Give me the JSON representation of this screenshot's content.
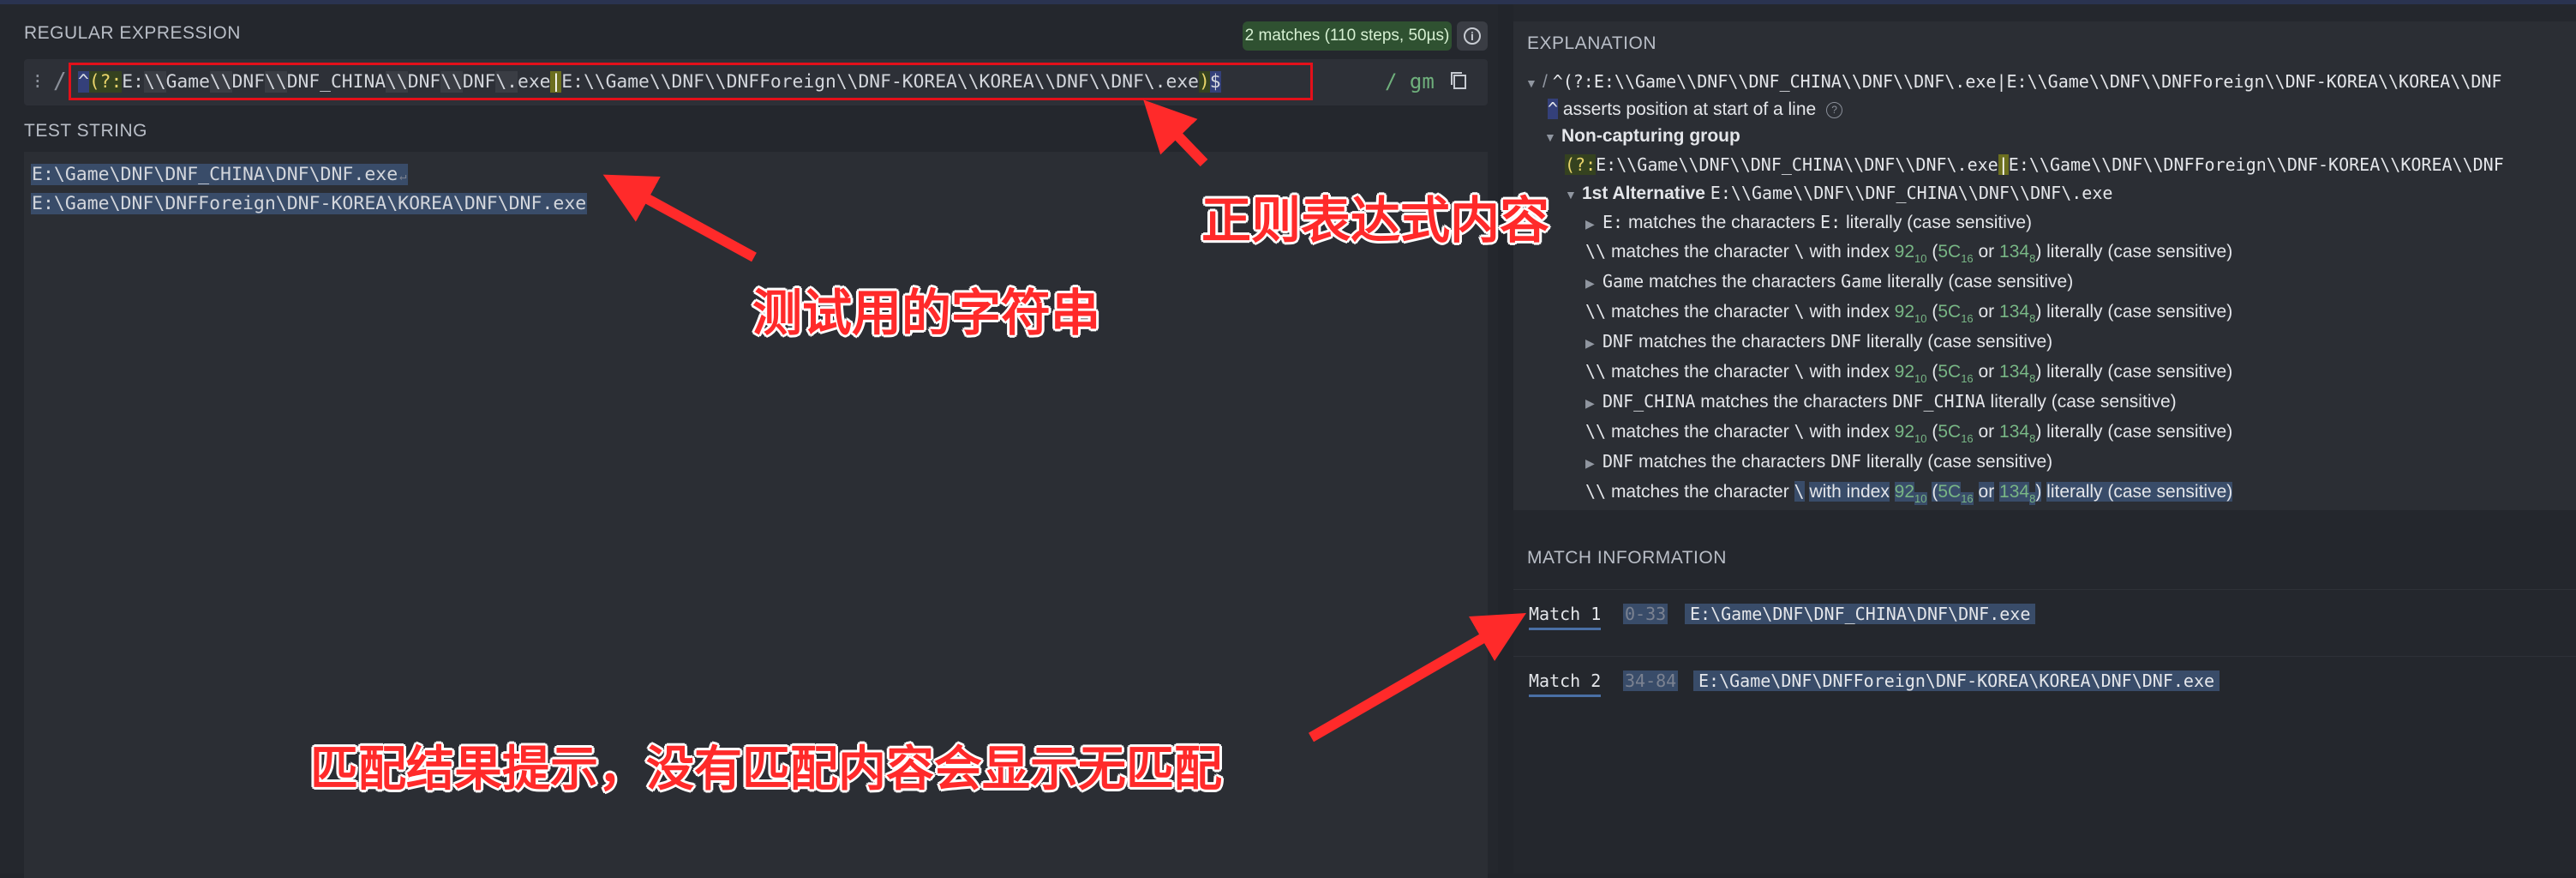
{
  "regex_panel": {
    "label": "REGULAR EXPRESSION",
    "match_badge": "2 matches (110 steps, 50µs)",
    "handle": "⁝",
    "open_delimiter": "/",
    "pattern_parts": {
      "anchor_start": "^",
      "group_open": "(?:",
      "alt1_a": "E:",
      "alt1_b": "\\\\",
      "alt1_c": "Game",
      "alt1_d": "\\\\",
      "alt1_e": "DNF",
      "alt1_f": "\\\\",
      "alt1_g": "DNF_CHINA",
      "alt1_h": "\\\\",
      "alt1_i": "DNF",
      "alt1_j": "\\\\",
      "alt1_k": "DNF",
      "alt1_l": "\\.",
      "alt1_m": "exe",
      "alt_bar": "|",
      "alt2": "E:\\\\Game\\\\DNF\\\\DNFForeign\\\\DNF-KOREA\\\\KOREA\\\\DNF\\\\DNF\\.exe",
      "group_close": ")",
      "anchor_end": "$"
    },
    "flags": "/ gm"
  },
  "test_panel": {
    "label": "TEST STRING",
    "lines": [
      "E:\\Game\\DNF\\DNF_CHINA\\DNF\\DNF.exe",
      "E:\\Game\\DNF\\DNFForeign\\DNF-KOREA\\KOREA\\DNF\\DNF.exe"
    ],
    "newline_mark": "↵"
  },
  "explanation": {
    "label": "EXPLANATION",
    "top_slash": "/",
    "top_pattern": "^(?:E:\\\\Game\\\\DNF\\\\DNF_CHINA\\\\DNF\\\\DNF\\.exe|E:\\\\Game\\\\DNF\\\\DNFForeign\\\\DNF-KOREA\\\\KOREA\\\\DNF",
    "caret_token": "^",
    "caret_text": "asserts position at start of a line",
    "group_title": "Non-capturing group",
    "group_pattern_prefix": "(?:",
    "group_pattern_rest": "E:\\\\Game\\\\DNF\\\\DNF_CHINA\\\\DNF\\\\DNF\\.exe",
    "group_pattern_bar": "|",
    "group_pattern_tail": "E:\\\\Game\\\\DNF\\\\DNFForeign\\\\DNF-KOREA\\\\KOREA\\\\DNF",
    "alt_title": "1st Alternative",
    "alt_code": "E:\\\\Game\\\\DNF\\\\DNF_CHINA\\\\DNF\\\\DNF\\.exe",
    "literal_rows": [
      {
        "token": "E:",
        "prefix": "matches the characters",
        "code": "E:",
        "suffix": "literally (case sensitive)"
      },
      {
        "token": "Game",
        "prefix": "matches the characters",
        "code": "Game",
        "suffix": "literally (case sensitive)"
      },
      {
        "token": "DNF",
        "prefix": "matches the characters",
        "code": "DNF",
        "suffix": "literally (case sensitive)"
      },
      {
        "token": "DNF_CHINA",
        "prefix": "matches the characters",
        "code": "DNF_CHINA",
        "suffix": "literally (case sensitive)"
      },
      {
        "token": "DNF",
        "prefix": "matches the characters",
        "code": "DNF",
        "suffix": "literally (case sensitive)"
      }
    ],
    "backslash_row": {
      "token": "\\\\",
      "text_a": "matches the character",
      "char": "\\",
      "text_b": "with index",
      "dec": "92",
      "dec_base": "10",
      "hex": "5C",
      "hex_base": "16",
      "or": "or",
      "oct": "134",
      "oct_base": "8",
      "tail": "literally (case sensitive)"
    }
  },
  "match_info": {
    "label": "MATCH INFORMATION",
    "matches": [
      {
        "name": "Match 1",
        "range": "0-33",
        "value": "E:\\Game\\DNF\\DNF_CHINA\\DNF\\DNF.exe"
      },
      {
        "name": "Match 2",
        "range": "34-84",
        "value": "E:\\Game\\DNF\\DNFForeign\\DNF-KOREA\\KOREA\\DNF\\DNF.exe"
      }
    ]
  },
  "annotations": {
    "regex_note": "正则表达式内容",
    "test_note": "测试用的字符串",
    "match_note": "匹配结果提示，没有匹配内容会显示无匹配",
    "color": "#ff2a2a"
  },
  "colors": {
    "background": "#22252b",
    "panel": "#2b2e34",
    "badge": "#2f5131",
    "selection": "#394c69",
    "highlight_red": "#e3101a"
  }
}
